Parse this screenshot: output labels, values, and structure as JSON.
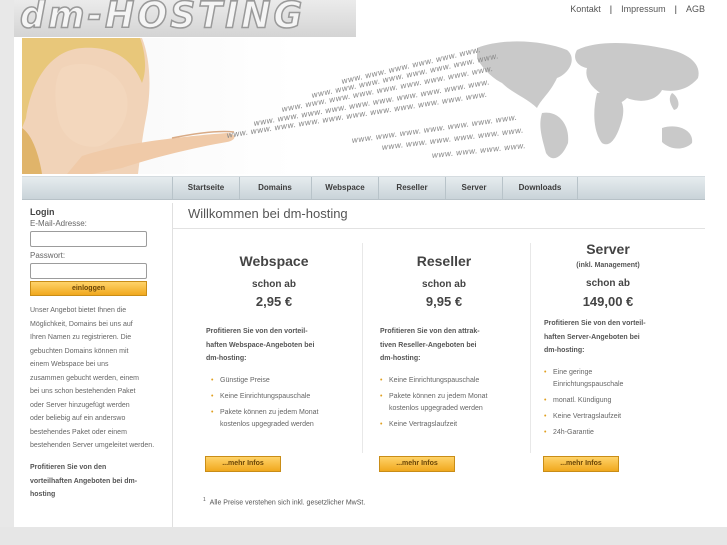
{
  "logo": {
    "text": "dm-HOSTING"
  },
  "topnav": {
    "items": [
      "Kontakt",
      "Impressum",
      "AGB"
    ],
    "separator": "|"
  },
  "banner": {
    "www_text": "www."
  },
  "nav": {
    "items": [
      "Startseite",
      "Domains",
      "Webspace",
      "Reseller",
      "Server",
      "Downloads"
    ]
  },
  "sidebar": {
    "login_title": "Login",
    "email_label": "E-Mail-Adresse:",
    "password_label": "Passwort:",
    "login_button": "einloggen",
    "text_lines": [
      "Unser Angebot bietet Ihnen die",
      "Möglichkeit, Domains bei uns auf",
      "Ihren Namen zu registrieren. Die",
      "gebuchten Domains können mit",
      "einem Webspace bei uns",
      "zusammen gebucht werden, einem",
      "bei uns schon bestehenden Paket",
      "oder Server hinzugefügt werden",
      "oder beliebig auf ein anderswo",
      "bestehendes Paket oder einem",
      "bestehenden Server umgeleitet werden."
    ],
    "promo_lines": [
      "Profitieren Sie von den",
      "vorteilhaften Angeboten bei dm-",
      "hosting"
    ]
  },
  "main": {
    "title": "Willkommen bei dm-hosting"
  },
  "plans": [
    {
      "name": "Webspace",
      "sub": "",
      "schon_ab": "schon ab",
      "price": "2,95 €",
      "intro": [
        "Profitieren Sie von den vorteil-",
        "haften Webspace-Angeboten bei",
        "dm-hosting:"
      ],
      "features": [
        "Günstige Preise",
        "Keine Einrichtungspauschale",
        "Pakete können zu jedem Monat",
        "kostenlos upgegraded werden"
      ],
      "button": "...mehr Infos"
    },
    {
      "name": "Reseller",
      "sub": "",
      "schon_ab": "schon ab",
      "price": "9,95 €",
      "intro": [
        "Profitieren Sie von den attrak-",
        "tiven Reseller-Angeboten bei",
        "dm-hosting:"
      ],
      "features": [
        "Keine Einrichtungspauschale",
        "Pakete können zu jedem Monat",
        "kostenlos upgegraded werden",
        "Keine Vertragslaufzeit"
      ],
      "button": "...mehr Infos"
    },
    {
      "name": "Server",
      "sub": "(inkl. Management)",
      "schon_ab": "schon ab",
      "price": "149,00 €",
      "intro": [
        "Profitieren Sie von den vorteil-",
        "haften Server-Angeboten bei",
        "dm-hosting:"
      ],
      "features": [
        "Eine geringe",
        "Einrichtungspauschale",
        "monatl. Kündigung",
        "Keine Vertragslaufzeit",
        "24h-Garantie"
      ],
      "button": "...mehr Infos"
    }
  ],
  "footnote": {
    "marker": "1",
    "text": "Alle Preise verstehen sich inkl. gesetzlicher MwSt."
  },
  "colors": {
    "accent": "#f0a81e",
    "nav_bg": "#d4dde2",
    "bullet": "#e0a020"
  }
}
